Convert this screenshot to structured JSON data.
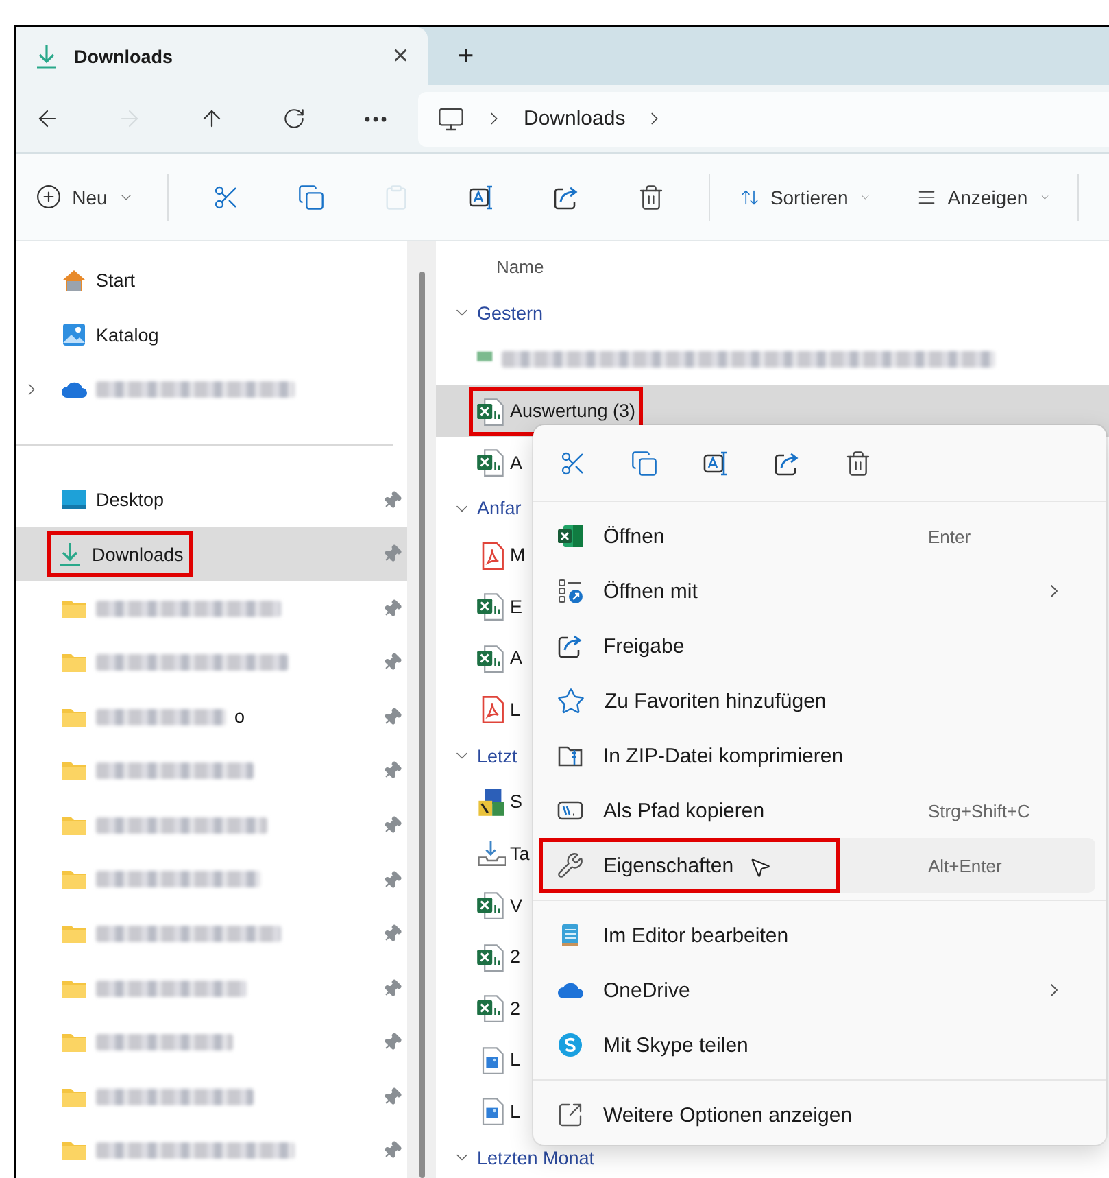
{
  "tabs": [
    {
      "title": "Downloads",
      "close": "×",
      "selected": true
    }
  ],
  "new_tab": "+",
  "nav": [
    {
      "kind": "back",
      "disabled": false
    },
    {
      "kind": "forward",
      "disabled": true
    },
    {
      "kind": "up",
      "disabled": false
    },
    {
      "kind": "refresh",
      "disabled": false
    },
    {
      "kind": "more",
      "disabled": false
    }
  ],
  "address": {
    "segments": [
      "Downloads"
    ]
  },
  "toolbar": [
    {
      "kind": "new",
      "label": "Neu",
      "disabled": false
    },
    {
      "kind": "cut",
      "disabled": false
    },
    {
      "kind": "copy",
      "disabled": false
    },
    {
      "kind": "paste",
      "disabled": true
    },
    {
      "kind": "rename",
      "disabled": false
    },
    {
      "kind": "share",
      "disabled": false
    },
    {
      "kind": "delete",
      "disabled": false
    },
    {
      "kind": "sort",
      "label": "Sortieren",
      "disabled": false
    },
    {
      "kind": "view",
      "label": "Anzeigen",
      "disabled": false
    }
  ],
  "sidebar": {
    "sections": [
      {
        "items": [
          {
            "kind": "home",
            "label": "Start",
            "selected": false,
            "pinned": false,
            "expandable": false,
            "redacted": false,
            "highlighted": false
          },
          {
            "kind": "gallery",
            "label": "Katalog",
            "selected": false,
            "pinned": false,
            "expandable": false,
            "redacted": false,
            "highlighted": false
          },
          {
            "kind": "cloud",
            "selected": false,
            "pinned": false,
            "expandable": true,
            "redacted": true,
            "highlighted": false
          }
        ]
      },
      {
        "items": [
          {
            "kind": "desktop",
            "label": "Desktop",
            "selected": false,
            "pinned": true,
            "expandable": false,
            "redacted": false,
            "highlighted": false
          },
          {
            "kind": "download",
            "label": "Downloads",
            "selected": true,
            "pinned": true,
            "expandable": false,
            "redacted": false,
            "highlighted": true
          },
          {
            "kind": "folder",
            "selected": false,
            "pinned": true,
            "expandable": false,
            "redacted": true,
            "highlighted": false
          },
          {
            "kind": "folder",
            "selected": false,
            "pinned": true,
            "expandable": false,
            "redacted": true,
            "highlighted": false
          },
          {
            "kind": "folder",
            "selected": false,
            "pinned": true,
            "expandable": false,
            "redacted": true,
            "highlighted": false,
            "name_tail": "o"
          },
          {
            "kind": "folder",
            "selected": false,
            "pinned": true,
            "expandable": false,
            "redacted": true,
            "highlighted": false
          },
          {
            "kind": "folder",
            "selected": false,
            "pinned": true,
            "expandable": false,
            "redacted": true,
            "highlighted": false
          },
          {
            "kind": "folder",
            "selected": false,
            "pinned": true,
            "expandable": false,
            "redacted": true,
            "highlighted": false
          },
          {
            "kind": "folder",
            "selected": false,
            "pinned": true,
            "expandable": false,
            "redacted": true,
            "highlighted": false
          },
          {
            "kind": "folder",
            "selected": false,
            "pinned": true,
            "expandable": false,
            "redacted": true,
            "highlighted": false
          },
          {
            "kind": "folder",
            "selected": false,
            "pinned": true,
            "expandable": false,
            "redacted": true,
            "highlighted": false
          },
          {
            "kind": "folder",
            "selected": false,
            "pinned": true,
            "expandable": false,
            "redacted": true,
            "highlighted": false
          },
          {
            "kind": "folder",
            "selected": false,
            "pinned": true,
            "expandable": false,
            "redacted": true,
            "highlighted": false
          }
        ]
      }
    ]
  },
  "file_list": {
    "header": "Name",
    "groups": [
      {
        "label": "Gestern",
        "files": [
          {
            "kind": "blurred",
            "redacted": true,
            "selected": false,
            "highlighted": false
          },
          {
            "kind": "excel",
            "name": "Auswertung (3)",
            "redacted": false,
            "selected": true,
            "highlighted": true
          },
          {
            "kind": "excel",
            "name": "A",
            "redacted": false,
            "selected": false,
            "highlighted": false
          }
        ]
      },
      {
        "label": "Anfar",
        "files": [
          {
            "kind": "pdf",
            "name": "M",
            "redacted": false,
            "selected": false,
            "highlighted": false
          },
          {
            "kind": "excel",
            "name": "E",
            "redacted": false,
            "selected": false,
            "highlighted": false
          },
          {
            "kind": "excel",
            "name": "A",
            "redacted": false,
            "selected": false,
            "highlighted": false
          },
          {
            "kind": "pdf",
            "name": "L",
            "redacted": false,
            "selected": false,
            "highlighted": false
          }
        ]
      },
      {
        "label": "Letzt",
        "files": [
          {
            "kind": "setup",
            "name": "S",
            "redacted": false,
            "selected": false,
            "highlighted": false
          },
          {
            "kind": "tray",
            "name": "Ta",
            "redacted": false,
            "selected": false,
            "highlighted": false
          },
          {
            "kind": "excel",
            "name": "V",
            "redacted": false,
            "selected": false,
            "highlighted": false
          },
          {
            "kind": "excel",
            "name": "2",
            "redacted": false,
            "selected": false,
            "highlighted": false
          },
          {
            "kind": "excel",
            "name": "2",
            "redacted": false,
            "selected": false,
            "highlighted": false
          },
          {
            "kind": "image",
            "name": "L",
            "redacted": false,
            "selected": false,
            "highlighted": false
          },
          {
            "kind": "image",
            "name": "L",
            "redacted": false,
            "selected": false,
            "highlighted": false
          }
        ]
      },
      {
        "label": "Letzten Monat"
      }
    ]
  },
  "context_menu": {
    "actions": [
      {
        "kind": "cut"
      },
      {
        "kind": "copy"
      },
      {
        "kind": "rename"
      },
      {
        "kind": "share"
      },
      {
        "kind": "delete"
      }
    ],
    "sections": [
      {
        "items": [
          {
            "kind": "excel",
            "label": "Öffnen",
            "shortcut": "Enter",
            "submenu": false,
            "hovered": false,
            "highlighted": false
          },
          {
            "kind": "openwith",
            "label": "Öffnen mit",
            "submenu": true,
            "hovered": false,
            "highlighted": false
          },
          {
            "kind": "share",
            "label": "Freigabe",
            "submenu": false,
            "hovered": false,
            "highlighted": false
          },
          {
            "kind": "star",
            "label": "Zu Favoriten hinzufügen",
            "submenu": false,
            "hovered": false,
            "highlighted": false
          },
          {
            "kind": "zip",
            "label": "In ZIP-Datei komprimieren",
            "submenu": false,
            "hovered": false,
            "highlighted": false
          },
          {
            "kind": "path",
            "label": "Als Pfad kopieren",
            "shortcut": "Strg+Shift+C",
            "submenu": false,
            "hovered": false,
            "highlighted": false
          },
          {
            "kind": "wrench",
            "label": "Eigenschaften",
            "shortcut": "Alt+Enter",
            "submenu": false,
            "hovered": true,
            "highlighted": true
          }
        ]
      },
      {
        "items": [
          {
            "kind": "notepad",
            "label": "Im Editor bearbeiten",
            "submenu": false,
            "hovered": false,
            "highlighted": false
          },
          {
            "kind": "cloud",
            "label": "OneDrive",
            "submenu": true,
            "hovered": false,
            "highlighted": false
          },
          {
            "kind": "skype",
            "label": "Mit Skype teilen",
            "submenu": false,
            "hovered": false,
            "highlighted": false
          }
        ]
      },
      {
        "items": [
          {
            "kind": "more",
            "label": "Weitere Optionen anzeigen",
            "submenu": false,
            "hovered": false,
            "highlighted": false
          }
        ]
      }
    ]
  }
}
